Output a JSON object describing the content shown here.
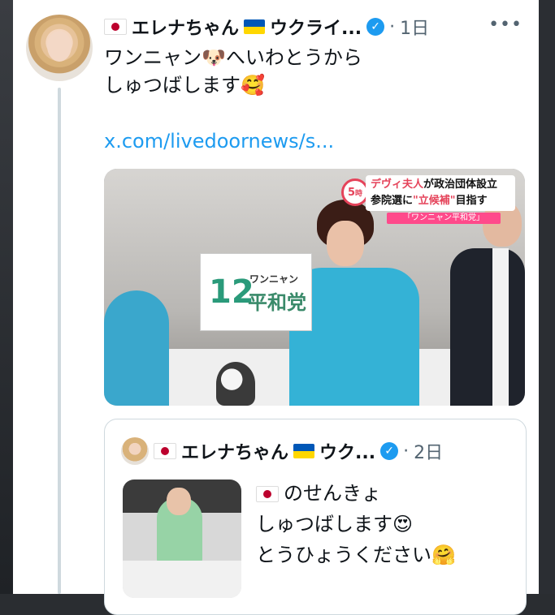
{
  "tweet": {
    "display_name": "エレナちゃん",
    "name_suffix": "ウクライ...",
    "separator": "·",
    "timestamp": "1日",
    "more": "•••",
    "text_line1": "ワンニャン🐶へいわとうから",
    "text_line2": "しゅつばします🥰",
    "link": "x.com/livedoornews/s...",
    "media": {
      "badge_num": "5",
      "badge_unit": "時",
      "headline_line1_red": "デヴィ夫人",
      "headline_line1": "が政治団体設立",
      "headline_line2_a": "参院選に",
      "headline_line2_red": "\"立候補\"",
      "headline_line2_b": "目指す",
      "strip": "「ワンニャン平和党」",
      "placard_number": "12",
      "placard_small": "ワンニャン",
      "placard_big": "平和党"
    }
  },
  "quoted": {
    "display_name": "エレナちゃん",
    "name_suffix": "ウク...",
    "separator": "·",
    "timestamp": "2日",
    "text_line1": "のせんきょ",
    "text_line2": "しゅつばします😍",
    "text_line3": "とうひょうください🤗"
  },
  "icons": [
    "flag-japan-icon",
    "flag-ukraine-icon",
    "verified-badge-icon",
    "more-options-icon"
  ],
  "colors": {
    "link": "#1d9bf0",
    "verified": "#1d9bf0",
    "muted": "#536471"
  }
}
